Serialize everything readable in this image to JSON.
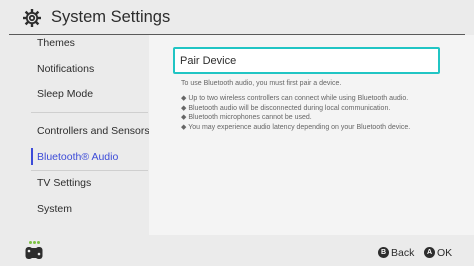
{
  "header": {
    "title": "System Settings"
  },
  "sidebar": {
    "items": [
      {
        "label": "Themes"
      },
      {
        "label": "Notifications"
      },
      {
        "label": "Sleep Mode"
      },
      {
        "label": "Controllers and Sensors"
      },
      {
        "label": "Bluetooth® Audio",
        "selected": true
      },
      {
        "label": "TV Settings"
      },
      {
        "label": "System"
      }
    ]
  },
  "main": {
    "pair_button": "Pair Device",
    "description": "To use Bluetooth audio, you must first pair a device.",
    "notes": [
      "◆ Up to two wireless controllers can connect while using Bluetooth audio.",
      "◆ Bluetooth audio will be disconnected during local communication.",
      "◆ Bluetooth microphones cannot be used.",
      "◆ You may experience audio latency depending on your Bluetooth device."
    ]
  },
  "footer": {
    "back_glyph": "B",
    "back_label": "Back",
    "ok_glyph": "A",
    "ok_label": "OK"
  },
  "colors": {
    "accent": "#3c4bd8",
    "focus": "#21c5c4",
    "controller_dot": "#7cc242"
  },
  "icons": [
    "gear-icon",
    "controller-icon",
    "b-button-icon",
    "a-button-icon"
  ]
}
